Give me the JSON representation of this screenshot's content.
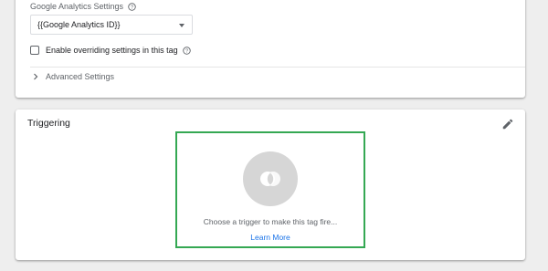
{
  "config": {
    "ga_settings_label": "Google Analytics Settings",
    "ga_settings_value": "{{Google Analytics ID}}",
    "override_label": "Enable overriding settings in this tag",
    "advanced_label": "Advanced Settings"
  },
  "triggering": {
    "title": "Triggering",
    "prompt": "Choose a trigger to make this tag fire...",
    "learn_more": "Learn More"
  },
  "colors": {
    "trigger_box_border": "#34a853",
    "link": "#1a73e8"
  },
  "icons": {
    "help": "help-icon",
    "dropdown": "caret-down-icon",
    "expand": "chevron-right-icon",
    "edit": "pencil-icon",
    "trigger": "trigger-icon"
  }
}
